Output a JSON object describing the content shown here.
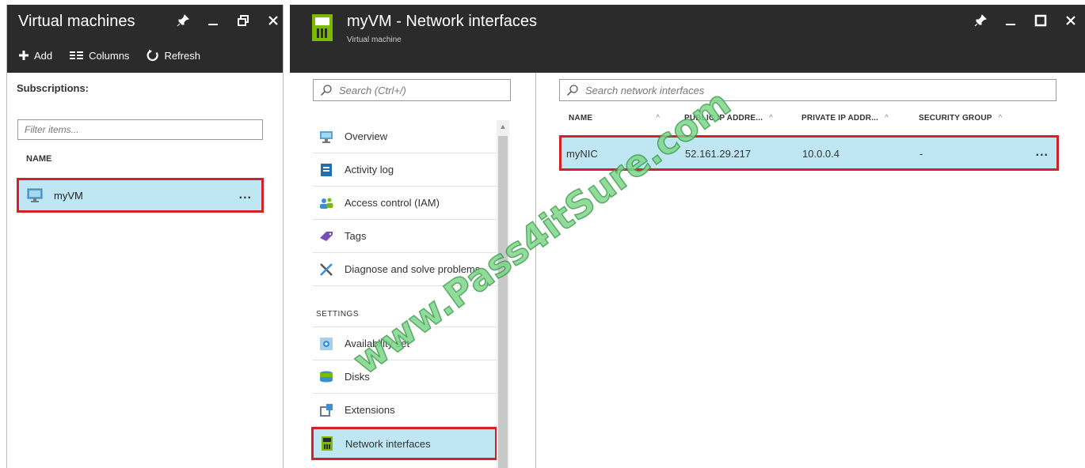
{
  "left_blade": {
    "title": "Virtual machines",
    "controls": [
      "pin-icon",
      "minimize-icon",
      "restore-icon",
      "close-icon"
    ],
    "toolbar": {
      "add_label": "Add",
      "columns_label": "Columns",
      "refresh_label": "Refresh"
    },
    "subscriptions_label": "Subscriptions:",
    "filter_placeholder": "Filter items...",
    "name_column": "NAME",
    "rows": [
      {
        "label": "myVM",
        "more": "..."
      }
    ]
  },
  "main_header": {
    "title": "myVM - Network interfaces",
    "subtitle": "Virtual machine",
    "controls": [
      "pin-icon",
      "minimize-icon",
      "maximize-icon",
      "close-icon"
    ]
  },
  "menu": {
    "search_placeholder": "Search (Ctrl+/)",
    "items": [
      {
        "label": "Overview",
        "icon": "monitor-icon"
      },
      {
        "label": "Activity log",
        "icon": "log-icon"
      },
      {
        "label": "Access control (IAM)",
        "icon": "users-icon"
      },
      {
        "label": "Tags",
        "icon": "tag-icon"
      },
      {
        "label": "Diagnose and solve problems",
        "icon": "wrench-icon"
      }
    ],
    "settings_heading": "SETTINGS",
    "settings_items": [
      {
        "label": "Availability set",
        "icon": "availability-icon"
      },
      {
        "label": "Disks",
        "icon": "disks-icon"
      },
      {
        "label": "Extensions",
        "icon": "extensions-icon"
      },
      {
        "label": "Network interfaces",
        "icon": "network-card-icon"
      }
    ]
  },
  "network_interfaces": {
    "search_placeholder": "Search network interfaces",
    "columns": [
      "NAME",
      "PUBLIC IP ADDRE...",
      "PRIVATE IP ADDR...",
      "SECURITY GROUP"
    ],
    "rows": [
      {
        "name": "myNIC",
        "public_ip": "52.161.29.217",
        "private_ip": "10.0.0.4",
        "security_group": "-",
        "more": "..."
      }
    ]
  },
  "watermark": "www.Pass4itSure.com",
  "colors": {
    "header_bg": "#2b2b2b",
    "selected_bg": "#bfe6f3",
    "highlight_border": "#d4202b",
    "vm_icon_green": "#7cba00"
  }
}
